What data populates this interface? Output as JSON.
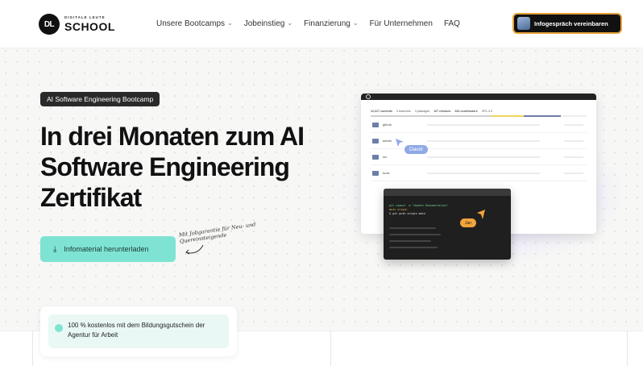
{
  "logo": {
    "badge": "DL",
    "small_text": "DIGITALE LEUTE",
    "name": "SCHOOL"
  },
  "nav": {
    "items": [
      {
        "label": "Unsere Bootcamps",
        "dropdown": true
      },
      {
        "label": "Jobeinstieg",
        "dropdown": true
      },
      {
        "label": "Finanzierung",
        "dropdown": true
      },
      {
        "label": "Für Unternehmen",
        "dropdown": false
      },
      {
        "label": "FAQ",
        "dropdown": false
      }
    ],
    "cta_label": "Infogespräch vereinbaren"
  },
  "hero": {
    "tag": "AI Software Engineering Bootcamp",
    "headline": "In drei Monaten zum AI Software Engineering Zertifikat",
    "download_label": "Infomaterial herunterladen",
    "handwritten_note": "Mit Jobgarantie für Neu- und Quereinsteigende"
  },
  "info_card": {
    "text": "100 % kostenlos mit dem Bildungsgutschein der Agentur für Arbeit"
  },
  "mockup": {
    "repo_stats": [
      "12,317 contents",
      "3 branches",
      "3 packages",
      "107 releases",
      "602 contributors",
      "GPL-3.0"
    ],
    "folders": [
      "github",
      "admin",
      "src",
      "tools"
    ],
    "cursor_labels": {
      "david": "David",
      "jan": "Jan"
    },
    "terminal_lines": [
      "git commit -m \"Update Dokumentation\"",
      "main origin",
      "$ git push origin main"
    ]
  },
  "colors": {
    "accent_teal": "#7fe3d3",
    "cta_border": "#e6a23a",
    "dark": "#111111",
    "cursor_blue": "#8fa9e6",
    "cursor_orange": "#f2a33a"
  }
}
